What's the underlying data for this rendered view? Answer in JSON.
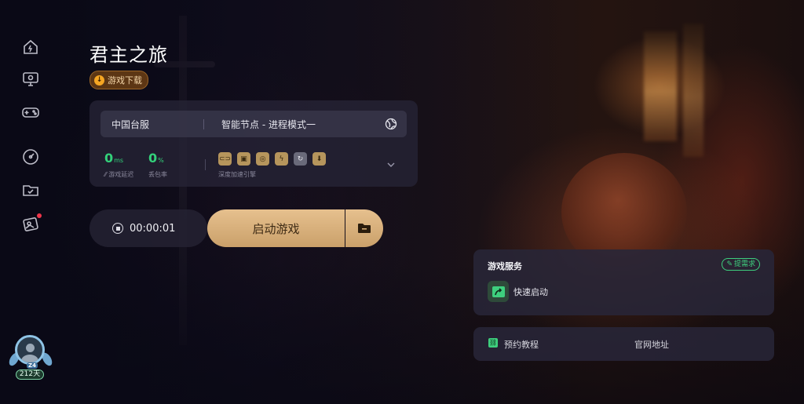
{
  "game": {
    "title": "君主之旅",
    "download_label": "游戏下载"
  },
  "accel": {
    "server": "中国台服",
    "mode": "智能节点 - 进程模式一",
    "latency_value": "0",
    "latency_unit": "ms",
    "latency_label": "游戏延迟",
    "loss_value": "0",
    "loss_unit": "%",
    "loss_label": "丢包率",
    "engine_label": "深度加速引擎",
    "engine_icons": [
      "link-icon",
      "window-icon",
      "route-icon",
      "bolt-icon",
      "refresh-icon",
      "download-icon"
    ]
  },
  "control": {
    "timer": "00:00:01",
    "start_label": "启动游戏"
  },
  "services": {
    "title": "游戏服务",
    "demand_label": "提需求",
    "quick_start_label": "快速启动",
    "tutorial_label": "预约教程",
    "website_label": "官网地址"
  },
  "user": {
    "level": "Z4",
    "days": "212天"
  },
  "sidebar": {
    "items": [
      "home-icon",
      "monitor-icon",
      "gamepad-icon",
      "speedometer-icon",
      "folder-icon",
      "gift-icon"
    ]
  },
  "colors": {
    "accent_green": "#33d17a",
    "gold": "#caa06a",
    "badge_red": "#f0364a"
  }
}
